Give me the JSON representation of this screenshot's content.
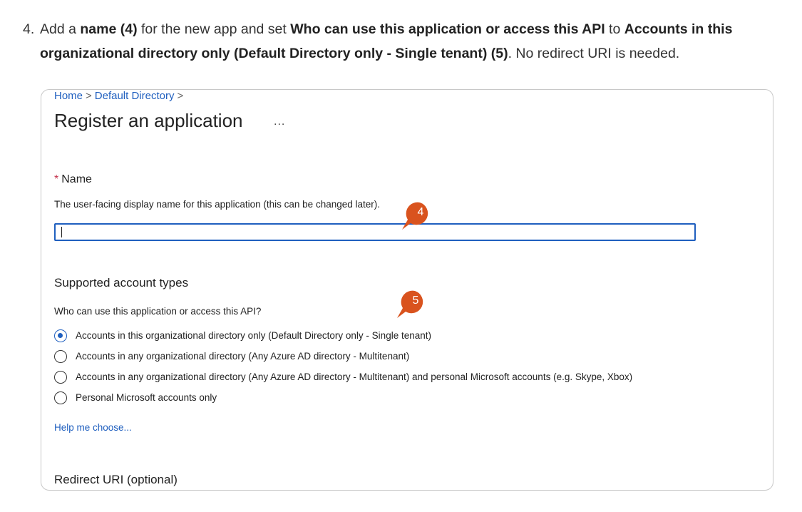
{
  "instruction": {
    "number": "4.",
    "p1": "Add a ",
    "b1": "name (4)",
    "p2": " for the new app and set ",
    "b2": "Who can use this application or access this API",
    "p3": " to ",
    "b3": "Accounts in this",
    "b4": "organizational directory only (Default Directory only - Single tenant) (5)",
    "p4": ". No redirect URI is needed."
  },
  "breadcrumb": {
    "home": "Home",
    "sep1": ">",
    "directory": "Default Directory",
    "sep2": ">"
  },
  "page": {
    "title": "Register an application",
    "more": "..."
  },
  "name_section": {
    "required_mark": "*",
    "label": "Name",
    "description": "The user-facing display name for this application (this can be changed later).",
    "value": ""
  },
  "account_types": {
    "title": "Supported account types",
    "question": "Who can use this application or access this API?",
    "options": [
      {
        "label": "Accounts in this organizational directory only (Default Directory only - Single tenant)",
        "selected": true
      },
      {
        "label": "Accounts in any organizational directory (Any Azure AD directory - Multitenant)",
        "selected": false
      },
      {
        "label": "Accounts in any organizational directory (Any Azure AD directory - Multitenant) and personal Microsoft accounts (e.g. Skype, Xbox)",
        "selected": false
      },
      {
        "label": "Personal Microsoft accounts only",
        "selected": false
      }
    ],
    "help_link": "Help me choose..."
  },
  "redirect": {
    "title": "Redirect URI (optional)"
  },
  "callouts": [
    {
      "label": "4"
    },
    {
      "label": "5"
    }
  ],
  "colors": {
    "accent": "#1f5fbf",
    "callout": "#d9531e",
    "required": "#c4314b"
  }
}
